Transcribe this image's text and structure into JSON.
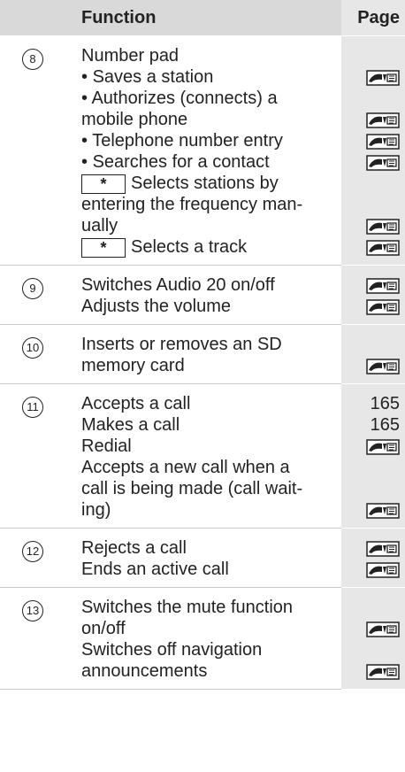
{
  "header": {
    "col_function": "Function",
    "col_page": "Page"
  },
  "rows": [
    {
      "num": "8",
      "lines": [
        {
          "text": "Number pad",
          "bullet": false
        },
        {
          "text": "Saves a station",
          "bullet": true
        },
        {
          "text": "Authorizes (connects) a",
          "bullet": true
        },
        {
          "text": "mobile phone",
          "bullet": false
        },
        {
          "text": "Telephone number entry",
          "bullet": true
        },
        {
          "text": "Searches for a contact",
          "bullet": true
        },
        {
          "text": "Selects stations by",
          "star": true
        },
        {
          "text": "entering the frequency man-",
          "bullet": false
        },
        {
          "text": "ually",
          "bullet": false
        },
        {
          "text": "Selects a track",
          "star": true
        }
      ],
      "pages": [
        "",
        "ref",
        "",
        "ref",
        "ref",
        "ref",
        "",
        "",
        "ref",
        "ref"
      ]
    },
    {
      "num": "9",
      "lines": [
        {
          "text": "Switches Audio 20 on/off"
        },
        {
          "text": "Adjusts the volume"
        }
      ],
      "pages": [
        "ref",
        "ref"
      ]
    },
    {
      "num": "10",
      "lines": [
        {
          "text": "Inserts or removes an SD"
        },
        {
          "text": "memory card"
        }
      ],
      "pages": [
        "",
        "ref"
      ]
    },
    {
      "num": "11",
      "lines": [
        {
          "text": "Accepts a call"
        },
        {
          "text": "Makes a call"
        },
        {
          "text": "Redial"
        },
        {
          "text": "Accepts a new call when a"
        },
        {
          "text": "call is being made (call wait-"
        },
        {
          "text": "ing)"
        }
      ],
      "pages": [
        "165",
        "165",
        "ref",
        "",
        "",
        "ref"
      ]
    },
    {
      "num": "12",
      "lines": [
        {
          "text": "Rejects a call"
        },
        {
          "text": "Ends an active call"
        }
      ],
      "pages": [
        "ref",
        "ref"
      ]
    },
    {
      "num": "13",
      "lines": [
        {
          "text": "Switches the mute function"
        },
        {
          "text": "on/off"
        },
        {
          "text": "Switches off navigation"
        },
        {
          "text": "announcements"
        }
      ],
      "pages": [
        "",
        "ref",
        "",
        "ref"
      ]
    }
  ],
  "star_key": "*",
  "ref_icon": "page-reference-icon"
}
